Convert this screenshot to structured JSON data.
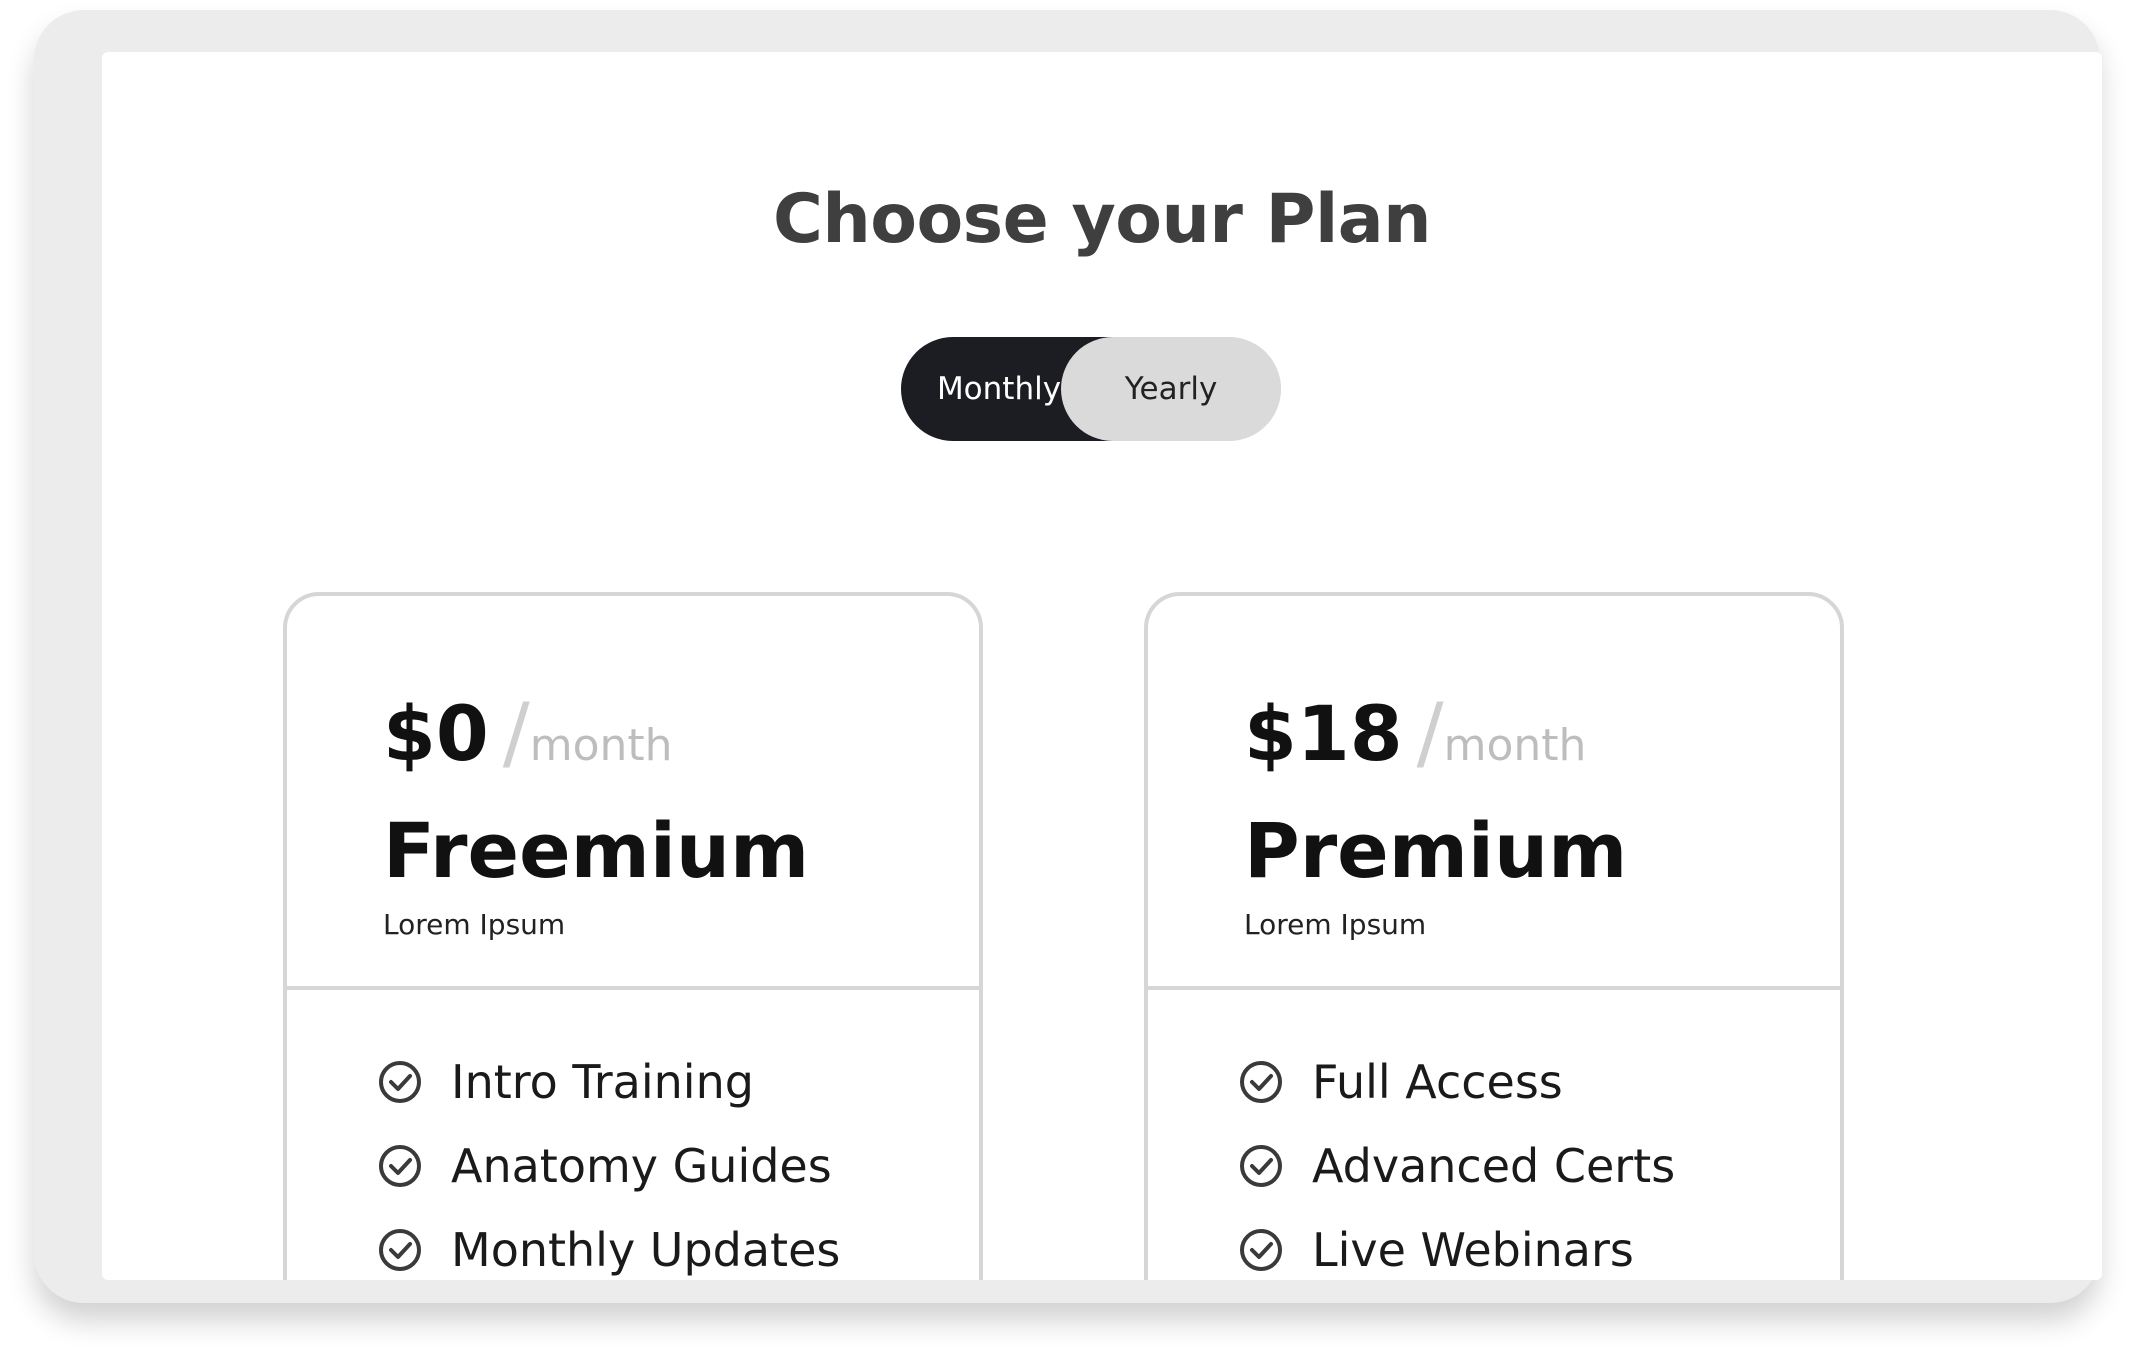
{
  "page": {
    "title": "Choose your Plan"
  },
  "billing_toggle": {
    "options": [
      "Monthly",
      "Yearly"
    ],
    "selected": "Monthly"
  },
  "plans": [
    {
      "price": "$0",
      "separator": "/",
      "period": "month",
      "name": "Freemium",
      "subtitle": "Lorem Ipsum",
      "features": [
        "Intro Training",
        "Anatomy Guides",
        "Monthly Updates"
      ]
    },
    {
      "price": "$18",
      "separator": "/",
      "period": "month",
      "name": "Premium",
      "subtitle": "Lorem Ipsum",
      "features": [
        "Full Access",
        "Advanced Certs",
        "Live Webinars"
      ]
    }
  ],
  "colors": {
    "toggle_active": "#1b1d22",
    "toggle_inactive": "#dadada",
    "title": "#3f3f3f",
    "card_border": "#d6d6d6",
    "period_text": "#bdbdbd"
  },
  "icons": {
    "feature_check": "check-circle-icon"
  }
}
